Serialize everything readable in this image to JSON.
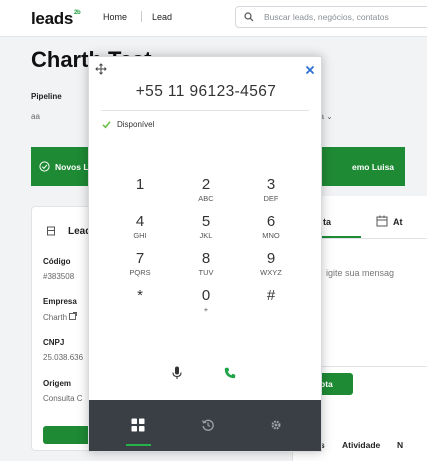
{
  "header": {
    "logo_text": "leads",
    "logo_badge": "2b",
    "nav_home": "Home",
    "nav_lead": "Lead",
    "search_placeholder": "Buscar leads, negócios, contatos"
  },
  "page": {
    "title": "Charth Test",
    "pipeline_label": "Pipeline",
    "pipeline_value": "aa",
    "stage_trail": "na ⌄"
  },
  "banner": {
    "left_text": "Novos Le",
    "right_text": "emo Luisa",
    "color": "#1e8a34"
  },
  "lead_card": {
    "title": "Lead",
    "fields": [
      {
        "label": "Código",
        "value": "#383508"
      },
      {
        "label": "Empresa",
        "value": "Charth"
      },
      {
        "label": "CNPJ",
        "value": "25.038.636"
      },
      {
        "label": "Origem",
        "value": "Consulta C"
      }
    ]
  },
  "right_panel": {
    "tab_active": "ta",
    "tab_other": "At",
    "message_placeholder": "igite sua mensag",
    "submit_label": "ota",
    "bottom_tabs": [
      "s",
      "Atividade",
      "N"
    ]
  },
  "dialer": {
    "phone_number": "+55 11 96123-4567",
    "status": "Disponível",
    "status_color": "#6cc04a",
    "keys": [
      {
        "digit": "1",
        "letters": ""
      },
      {
        "digit": "2",
        "letters": "ABC"
      },
      {
        "digit": "3",
        "letters": "DEF"
      },
      {
        "digit": "4",
        "letters": "GHI"
      },
      {
        "digit": "5",
        "letters": "JKL"
      },
      {
        "digit": "6",
        "letters": "MNO"
      },
      {
        "digit": "7",
        "letters": "PQRS"
      },
      {
        "digit": "8",
        "letters": "TUV"
      },
      {
        "digit": "9",
        "letters": "WXYZ"
      },
      {
        "digit": "*",
        "letters": ""
      },
      {
        "digit": "0",
        "letters": "+"
      },
      {
        "digit": "#",
        "letters": ""
      }
    ],
    "footer_color": "#3a3e45",
    "accent_color": "#26b34a",
    "icons": [
      "move-icon",
      "close-icon",
      "microphone-icon",
      "phone-call-icon",
      "keypad-grid-icon",
      "history-icon",
      "settings-gear-icon"
    ]
  }
}
